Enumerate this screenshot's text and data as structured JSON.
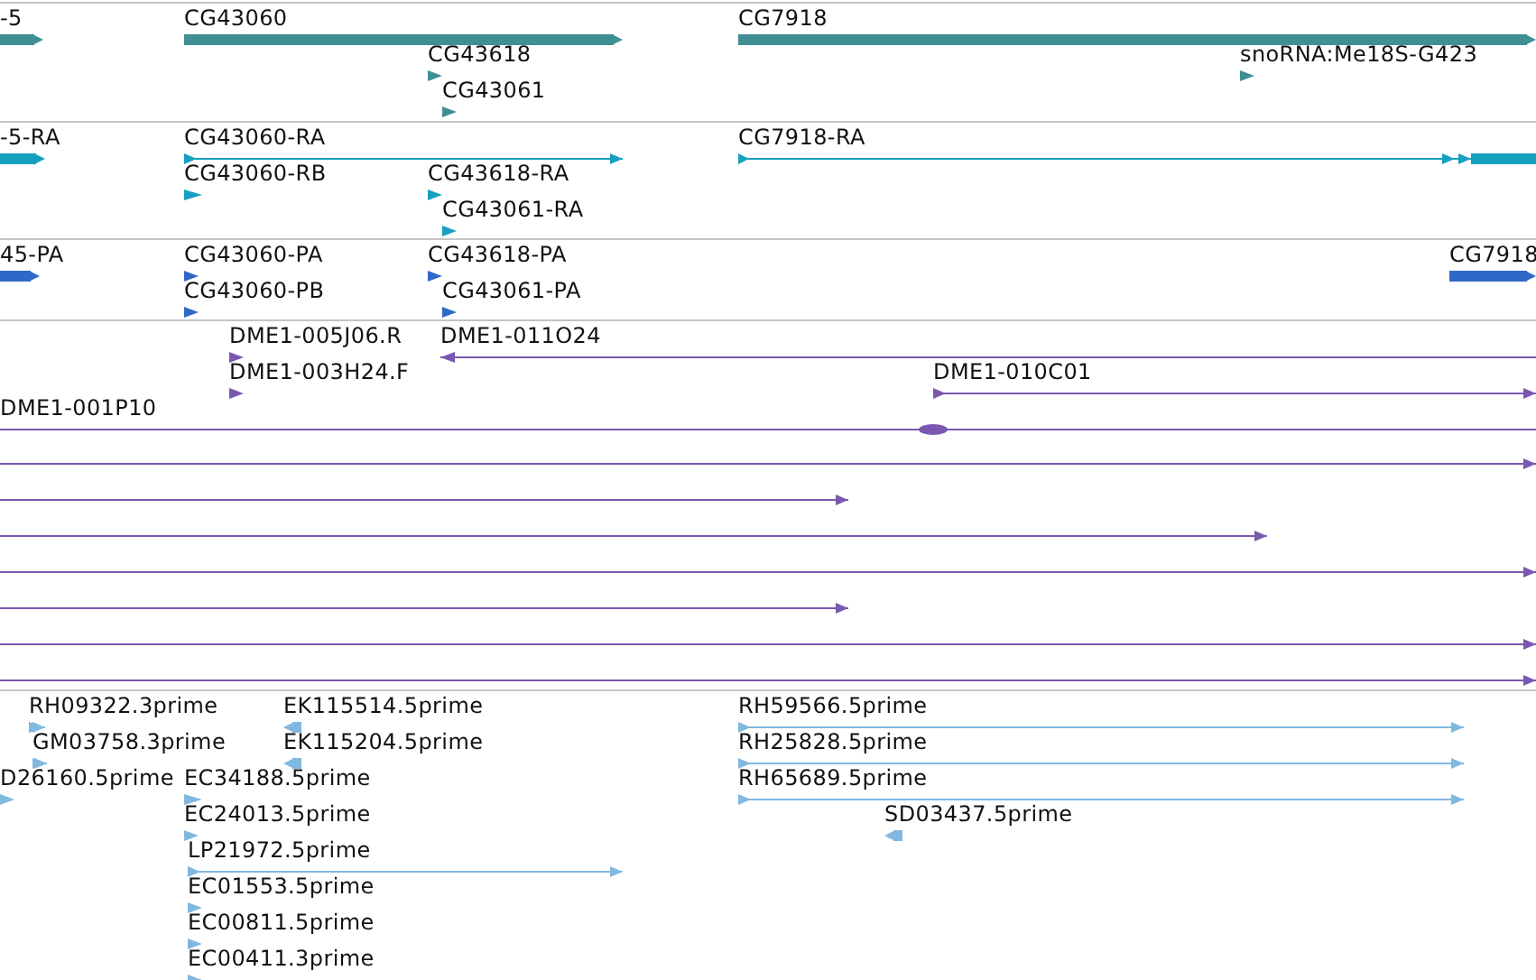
{
  "tracks": [
    {
      "color": "#3f8f94",
      "features": [
        {
          "label": "-5",
          "kind": "bar"
        },
        {
          "label": "CG43060",
          "kind": "bar"
        },
        {
          "label": "CG43618",
          "kind": "arrow"
        },
        {
          "label": "CG43061",
          "kind": "arrow"
        },
        {
          "label": "CG7918",
          "kind": "bar"
        },
        {
          "label": "snoRNA:Me18S-G423",
          "kind": "arrow"
        }
      ]
    },
    {
      "color": "#16a0c0",
      "features": [
        {
          "label": "-5-RA",
          "kind": "bar"
        },
        {
          "label": "CG43060-RA",
          "kind": "line"
        },
        {
          "label": "CG43060-RB",
          "kind": "arrow"
        },
        {
          "label": "CG43618-RA",
          "kind": "arrow"
        },
        {
          "label": "CG43061-RA",
          "kind": "arrow"
        },
        {
          "label": "CG7918-RA",
          "kind": "line-thick-end"
        }
      ]
    },
    {
      "color": "#3068c8",
      "features": [
        {
          "label": "45-PA",
          "kind": "bar"
        },
        {
          "label": "CG43060-PA",
          "kind": "arrow"
        },
        {
          "label": "CG43060-PB",
          "kind": "arrow"
        },
        {
          "label": "CG43618-PA",
          "kind": "arrow"
        },
        {
          "label": "CG43061-PA",
          "kind": "arrow"
        },
        {
          "label": "CG7918",
          "kind": "bar"
        }
      ]
    },
    {
      "color": "#7a58b0",
      "features": [
        {
          "label": "DME1-005J06.R",
          "kind": "arrow"
        },
        {
          "label": "DME1-011O24",
          "kind": "line-reverse"
        },
        {
          "label": "DME1-003H24.F",
          "kind": "arrow"
        },
        {
          "label": "DME1-010C01",
          "kind": "line"
        },
        {
          "label": "DME1-001P10",
          "kind": "line-blob"
        },
        {
          "kind": "line"
        },
        {
          "kind": "line"
        },
        {
          "kind": "line"
        },
        {
          "kind": "line"
        },
        {
          "kind": "line"
        },
        {
          "kind": "line"
        },
        {
          "kind": "line"
        }
      ]
    },
    {
      "color": "#80b8e0",
      "features": [
        {
          "label": "RH09322.3prime",
          "kind": "line"
        },
        {
          "label": "GM03758.3prime",
          "kind": "line"
        },
        {
          "label": "D26160.5prime",
          "kind": "arrow"
        },
        {
          "label": "EK115514.5prime",
          "kind": "reverse"
        },
        {
          "label": "EK115204.5prime",
          "kind": "reverse"
        },
        {
          "label": "EC34188.5prime",
          "kind": "arrow"
        },
        {
          "label": "EC24013.5prime",
          "kind": "arrow"
        },
        {
          "label": "LP21972.5prime",
          "kind": "line"
        },
        {
          "label": "EC01553.5prime",
          "kind": "arrow"
        },
        {
          "label": "EC00811.5prime",
          "kind": "arrow"
        },
        {
          "label": "EC00411.3prime",
          "kind": "arrow"
        },
        {
          "label": "RH59566.5prime",
          "kind": "line"
        },
        {
          "label": "RH25828.5prime",
          "kind": "line"
        },
        {
          "label": "RH65689.5prime",
          "kind": "line"
        },
        {
          "label": "SD03437.5prime",
          "kind": "reverse"
        }
      ]
    }
  ]
}
